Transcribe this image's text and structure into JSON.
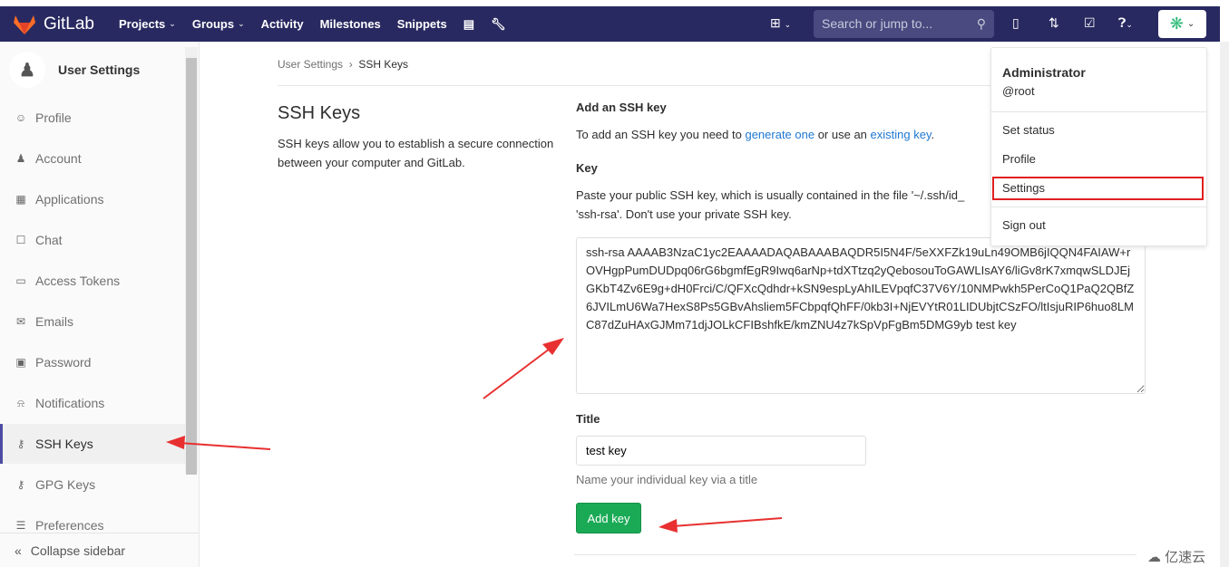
{
  "navbar": {
    "brand": "GitLab",
    "items": [
      {
        "label": "Projects",
        "dropdown": true
      },
      {
        "label": "Groups",
        "dropdown": true
      },
      {
        "label": "Activity"
      },
      {
        "label": "Milestones"
      },
      {
        "label": "Snippets"
      }
    ],
    "search_placeholder": "Search or jump to...",
    "bg": "#292961"
  },
  "sidebar": {
    "title": "User Settings",
    "items": [
      {
        "label": "Profile",
        "icon": "profile-icon"
      },
      {
        "label": "Account",
        "icon": "account-icon"
      },
      {
        "label": "Applications",
        "icon": "applications-icon"
      },
      {
        "label": "Chat",
        "icon": "chat-icon"
      },
      {
        "label": "Access Tokens",
        "icon": "token-icon"
      },
      {
        "label": "Emails",
        "icon": "email-icon"
      },
      {
        "label": "Password",
        "icon": "lock-icon"
      },
      {
        "label": "Notifications",
        "icon": "bell-icon"
      },
      {
        "label": "SSH Keys",
        "icon": "key-icon",
        "active": true
      },
      {
        "label": "GPG Keys",
        "icon": "key-icon"
      },
      {
        "label": "Preferences",
        "icon": "preferences-icon"
      }
    ],
    "collapse": "Collapse sidebar"
  },
  "breadcrumb": [
    "User Settings",
    "SSH Keys"
  ],
  "page": {
    "title": "SSH Keys",
    "description": "SSH keys allow you to establish a secure connection between your computer and GitLab."
  },
  "form": {
    "heading": "Add an SSH key",
    "intro_pre": "To add an SSH key you need to ",
    "generate_link": "generate one",
    "intro_mid": " or use an ",
    "existing_link": "existing key",
    "intro_post": ".",
    "key_label": "Key",
    "key_help_1": "Paste your public SSH key, which is usually contained in the file '~/.ssh/id_",
    "key_help_2": "'ssh-rsa'. Don't use your private SSH key.",
    "key_value": "ssh-rsa AAAAB3NzaC1yc2EAAAADAQABAAABAQDR5I5N4F/5eXXFZk19uLn49OMB6jIQQN4FAIAW+rOVHgpPumDUDpq06rG6bgmfEgR9Iwq6arNp+tdXTtzq2yQebosouToGAWLIsAY6/liGv8rK7xmqwSLDJEjGKbT4Zv6E9g+dH0Frci/C/QFXcQdhdr+kSN9espLyAhILEVpqfC37V6Y/10NMPwkh5PerCoQ1PaQ2QBfZ6JVILmU6Wa7HexS8Ps5GBvAhsliem5FCbpqfQhFF/0kb3I+NjEVYtR01LIDUbjtCSzFO/ltIsjuRIP6huo8LMC87dZuHAxGJMm71djJOLkCFIBshfkE/kmZNU4z7kSpVpFgBm5DMG9yb test key",
    "title_label": "Title",
    "title_value": "test key",
    "title_help": "Name your individual key via a title",
    "submit": "Add key",
    "accent": "#1aaa55"
  },
  "user_menu": {
    "name": "Administrator",
    "username": "@root",
    "items": [
      "Set status",
      "Profile",
      "Settings",
      "Sign out"
    ],
    "highlighted": "Settings"
  },
  "watermark": "亿速云"
}
